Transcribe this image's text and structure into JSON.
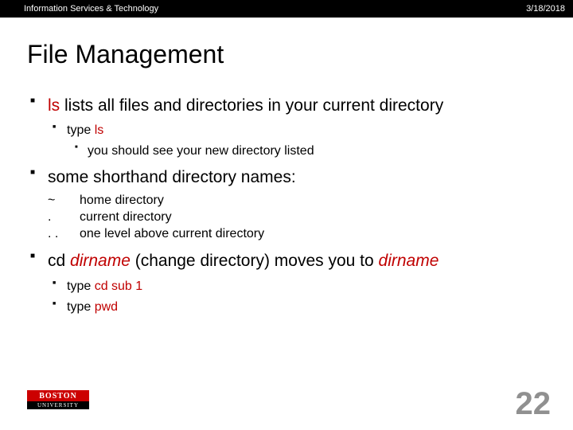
{
  "header": {
    "org": "Information Services & Technology",
    "date": "3/18/2018"
  },
  "title": "File Management",
  "bullets": [
    {
      "parts": [
        {
          "text": "ls",
          "red": true
        },
        {
          "text": " lists all files and directories in your current directory"
        }
      ],
      "sub": [
        {
          "parts": [
            {
              "text": "type "
            },
            {
              "text": "ls",
              "red": true
            }
          ],
          "sub": [
            {
              "parts": [
                {
                  "text": "you should see your new directory listed"
                }
              ]
            }
          ]
        }
      ]
    },
    {
      "parts": [
        {
          "text": "some shorthand directory names:"
        }
      ],
      "defs": [
        {
          "sym": "~",
          "desc": "home directory"
        },
        {
          "sym": ".",
          "desc": "current directory"
        },
        {
          "sym": ". .",
          "desc": "one level above current directory"
        }
      ]
    },
    {
      "parts": [
        {
          "text": "cd "
        },
        {
          "text": "dirname",
          "red": true,
          "italic": true
        },
        {
          "text": " (change directory) moves you to "
        },
        {
          "text": "dirname",
          "red": true,
          "italic": true
        }
      ],
      "sub": [
        {
          "parts": [
            {
              "text": "type "
            },
            {
              "text": "cd sub 1",
              "red": true
            }
          ]
        },
        {
          "parts": [
            {
              "text": "type "
            },
            {
              "text": "pwd",
              "red": true
            }
          ]
        }
      ]
    }
  ],
  "logo": {
    "top": "BOSTON",
    "bottom": "UNIVERSITY"
  },
  "page": "22"
}
